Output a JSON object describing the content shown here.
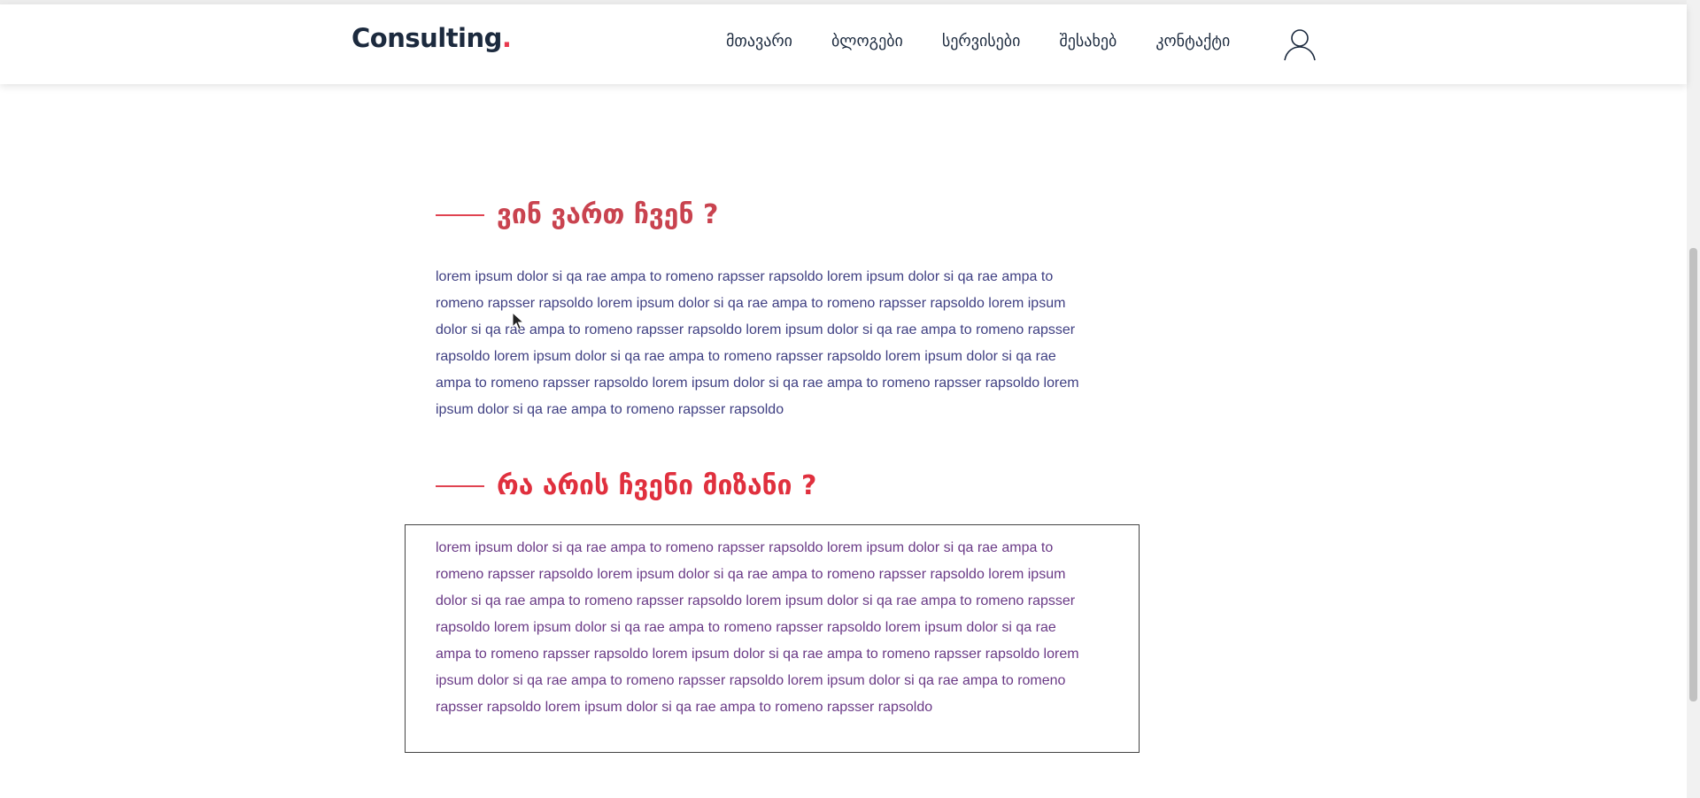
{
  "header": {
    "logo_text": "Consulting",
    "logo_dot": ".",
    "nav": [
      {
        "label": "მთავარი"
      },
      {
        "label": "ბლოგები"
      },
      {
        "label": "სერვისები"
      },
      {
        "label": "შესახებ"
      },
      {
        "label": "კონტაქტი"
      }
    ],
    "user_icon": "user-icon"
  },
  "section_about": {
    "title": "ვინ ვართ ჩვენ ?",
    "title_color": "#c9434f",
    "text": "lorem ipsum dolor si qa rae ampa to romeno rapsser rapsoldo lorem ipsum dolor si qa rae ampa to romeno rapsser rapsoldo lorem ipsum dolor si qa rae ampa to romeno rapsser rapsoldo lorem ipsum dolor si qa rae ampa to romeno rapsser rapsoldo lorem ipsum dolor si qa rae ampa to romeno rapsser rapsoldo lorem ipsum dolor si qa rae ampa to romeno rapsser rapsoldo lorem ipsum dolor si qa rae ampa to romeno rapsser rapsoldo lorem ipsum dolor si qa rae ampa to romeno rapsser rapsoldo lorem ipsum dolor si qa rae ampa to romeno rapsser rapsoldo",
    "text_color": "#3f3f82"
  },
  "section_goal": {
    "title": "რა არის ჩვენი მიზანი ?",
    "title_color": "#e0303e",
    "text": "lorem ipsum dolor si qa rae ampa to romeno rapsser rapsoldo lorem ipsum dolor si qa rae ampa to romeno rapsser rapsoldo lorem ipsum dolor si qa rae ampa to romeno rapsser rapsoldo lorem ipsum dolor si qa rae ampa to romeno rapsser rapsoldo lorem ipsum dolor si qa rae ampa to romeno rapsser rapsoldo lorem ipsum dolor si qa rae ampa to romeno rapsser rapsoldo lorem ipsum dolor si qa rae ampa to romeno rapsser rapsoldo lorem ipsum dolor si qa rae ampa to romeno rapsser rapsoldo lorem ipsum dolor si qa rae ampa to romeno rapsser rapsoldo lorem ipsum dolor si qa rae ampa to romeno rapsser rapsoldo lorem ipsum dolor si qa rae ampa to romeno rapsser rapsoldo",
    "text_color": "#6a3a86"
  },
  "colors": {
    "accent": "#e8394e",
    "nav_text": "#1c2a3e"
  }
}
